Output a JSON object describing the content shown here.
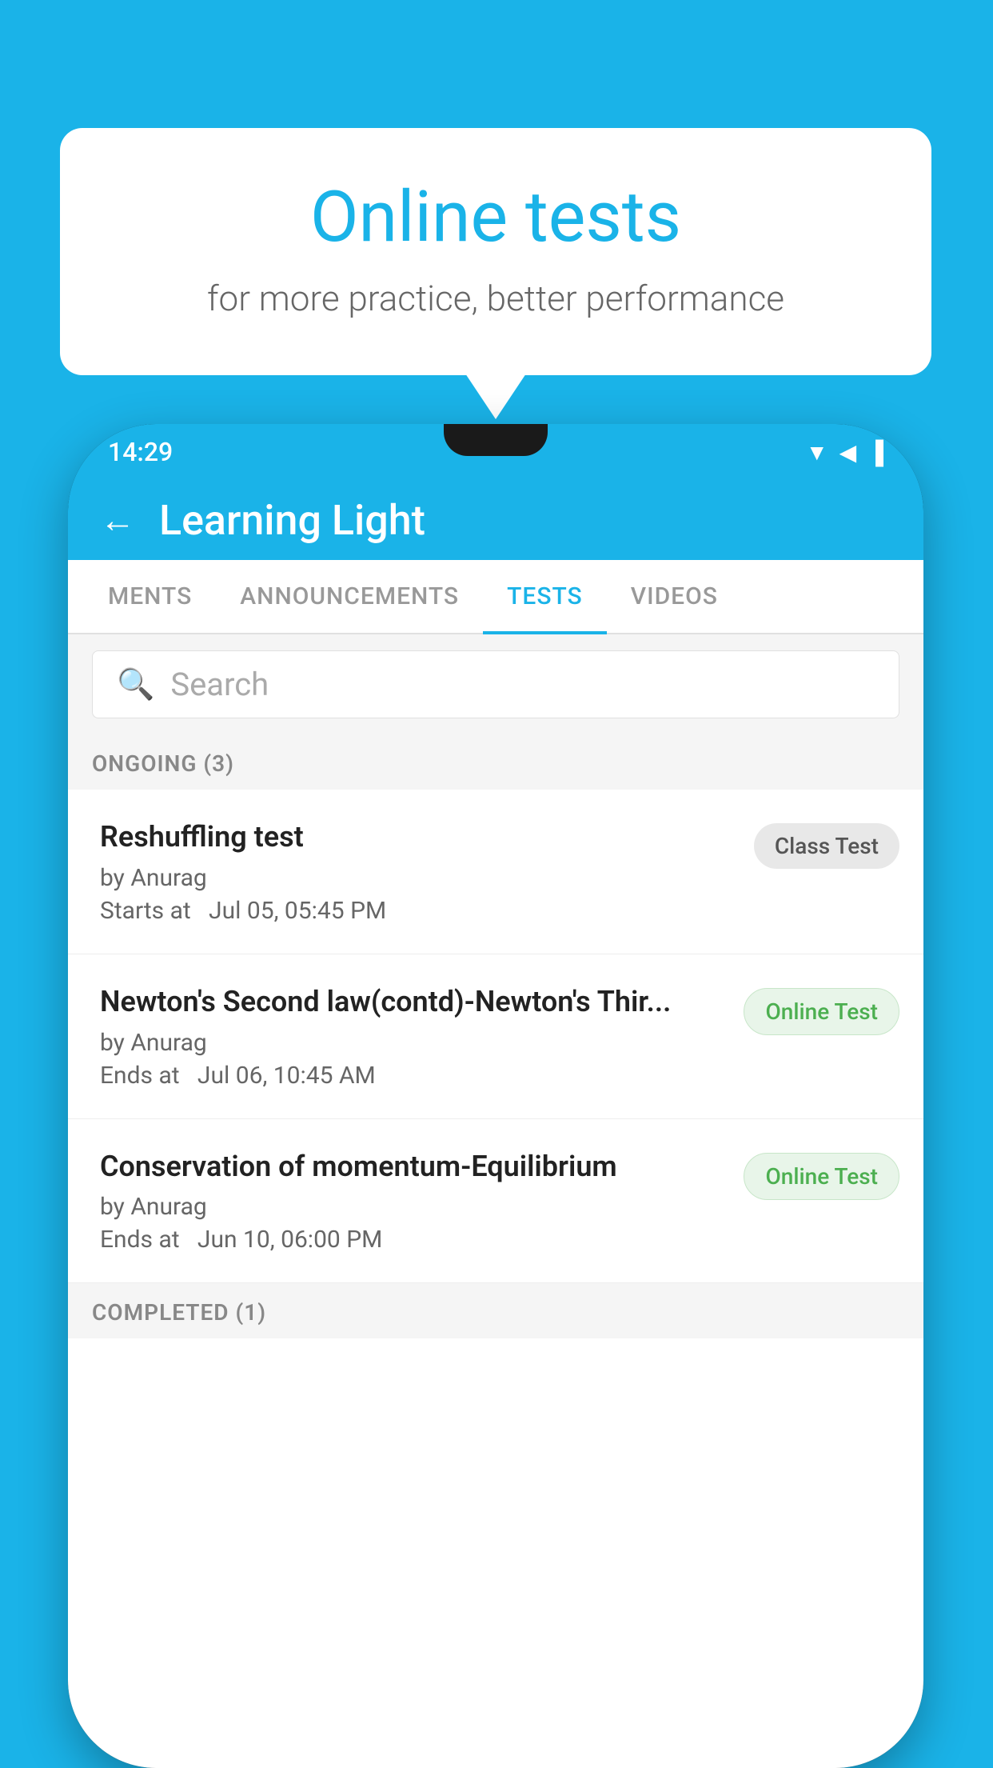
{
  "background": {
    "color": "#1ab3e8"
  },
  "bubble": {
    "title": "Online tests",
    "subtitle": "for more practice, better performance"
  },
  "status_bar": {
    "time": "14:29",
    "icons": [
      "wifi",
      "signal",
      "battery"
    ]
  },
  "app_header": {
    "back_label": "←",
    "title": "Learning Light"
  },
  "tabs": [
    {
      "label": "MENTS",
      "active": false
    },
    {
      "label": "ANNOUNCEMENTS",
      "active": false
    },
    {
      "label": "TESTS",
      "active": true
    },
    {
      "label": "VIDEOS",
      "active": false
    }
  ],
  "search": {
    "placeholder": "Search",
    "icon": "🔍"
  },
  "sections": {
    "ongoing": {
      "label": "ONGOING (3)",
      "tests": [
        {
          "name": "Reshuffling test",
          "author": "by Anurag",
          "date": "Starts at  Jul 05, 05:45 PM",
          "badge": "Class Test",
          "badge_type": "class"
        },
        {
          "name": "Newton's Second law(contd)-Newton's Thir...",
          "author": "by Anurag",
          "date": "Ends at  Jul 06, 10:45 AM",
          "badge": "Online Test",
          "badge_type": "online"
        },
        {
          "name": "Conservation of momentum-Equilibrium",
          "author": "by Anurag",
          "date": "Ends at  Jun 10, 06:00 PM",
          "badge": "Online Test",
          "badge_type": "online"
        }
      ]
    },
    "completed": {
      "label": "COMPLETED (1)"
    }
  }
}
